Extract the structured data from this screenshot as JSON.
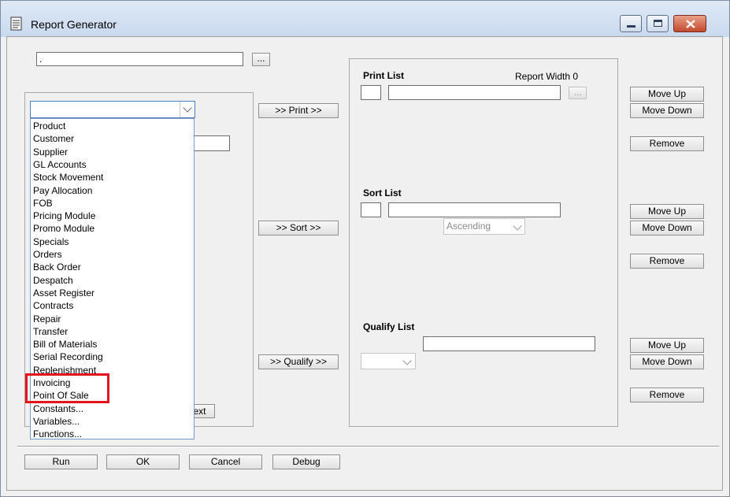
{
  "window": {
    "title": "Report Generator"
  },
  "top": {
    "path_value": ".",
    "browse_label": "..."
  },
  "dropdown": {
    "selected": "",
    "items": [
      "Product",
      "Customer",
      "Supplier",
      "GL Accounts",
      "Stock Movement",
      "Pay Allocation",
      "FOB",
      "Pricing Module",
      "Promo Module",
      "Specials",
      "Orders",
      "Back Order",
      "Despatch",
      "Asset Register",
      "Contracts",
      "Repair",
      "Transfer",
      "Bill of Materials",
      "Serial Recording",
      "Replenishment",
      "Invoicing",
      "Point Of Sale",
      "Constants...",
      "Variables...",
      "Functions..."
    ],
    "highlighted": [
      "Invoicing",
      "Point Of Sale"
    ]
  },
  "behind": {
    "next_label": "ext"
  },
  "middle": {
    "print_btn": ">> Print >>",
    "sort_btn": ">> Sort >>",
    "qualify_btn": ">> Qualify >>"
  },
  "print_list": {
    "label": "Print List",
    "report_width": "Report Width 0",
    "browse_label": "..."
  },
  "sort_list": {
    "label": "Sort List",
    "order": "Ascending"
  },
  "qualify_list": {
    "label": "Qualify List"
  },
  "side": {
    "move_up": "Move Up",
    "move_down": "Move Down",
    "remove": "Remove"
  },
  "bottom": {
    "run": "Run",
    "ok": "OK",
    "cancel": "Cancel",
    "debug": "Debug"
  },
  "colors": {
    "highlight": "#e3141b",
    "title_bar": "#c9d9ee"
  }
}
